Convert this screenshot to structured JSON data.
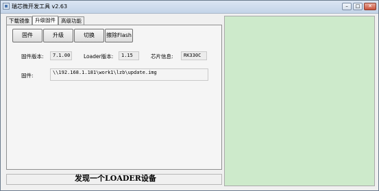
{
  "window": {
    "title": "瑞芯微开发工具 v2.63",
    "min_symbol": "–",
    "max_symbol": "□",
    "close_symbol": "✕"
  },
  "tabs": [
    {
      "label": "下载镜像",
      "active": false
    },
    {
      "label": "升级固件",
      "active": true
    },
    {
      "label": "高级功能",
      "active": false
    }
  ],
  "buttons": {
    "firmware": "固件",
    "upgrade": "升级",
    "switch": "切换",
    "erase_flash": "擦除Flash"
  },
  "info": {
    "firmware_version_label": "固件版本:",
    "firmware_version_value": "7.1.00",
    "loader_version_label": "Loader版本:",
    "loader_version_value": "1.15",
    "chip_info_label": "芯片信息:",
    "chip_info_value": "RK330C",
    "firmware_label": "固件:",
    "firmware_path": "\\\\192.168.1.181\\work1\\lzb\\update.img"
  },
  "status": {
    "message": "发现一个LOADER设备"
  },
  "colors": {
    "log_panel": "#cdeacb"
  }
}
